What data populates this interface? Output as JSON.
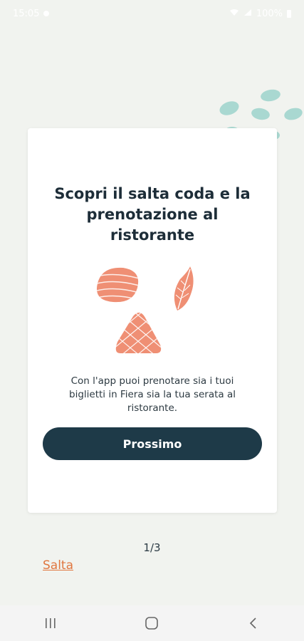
{
  "status_bar": {
    "time": "15:05",
    "battery": "100%",
    "icons": [
      "location-icon",
      "wifi-icon",
      "signal-icon",
      "battery-icon"
    ]
  },
  "onboarding": {
    "title": "Scopri il salta coda e la prenotazione al ristorante",
    "description": "Con l'app puoi prenotare sia i tuoi biglietti in Fiera sia la tua serata al ristorante.",
    "next_label": "Prossimo",
    "pager": "1/3",
    "skip_label": "Salta"
  },
  "nav_bar": {
    "icons": [
      "recent-apps-icon",
      "home-icon",
      "back-icon"
    ]
  },
  "colors": {
    "background": "#f1f3ef",
    "card": "#ffffff",
    "primary": "#1e3a48",
    "accent": "#e0763f",
    "illustration": "#ef8f74",
    "decor": "#a9d8d1"
  }
}
